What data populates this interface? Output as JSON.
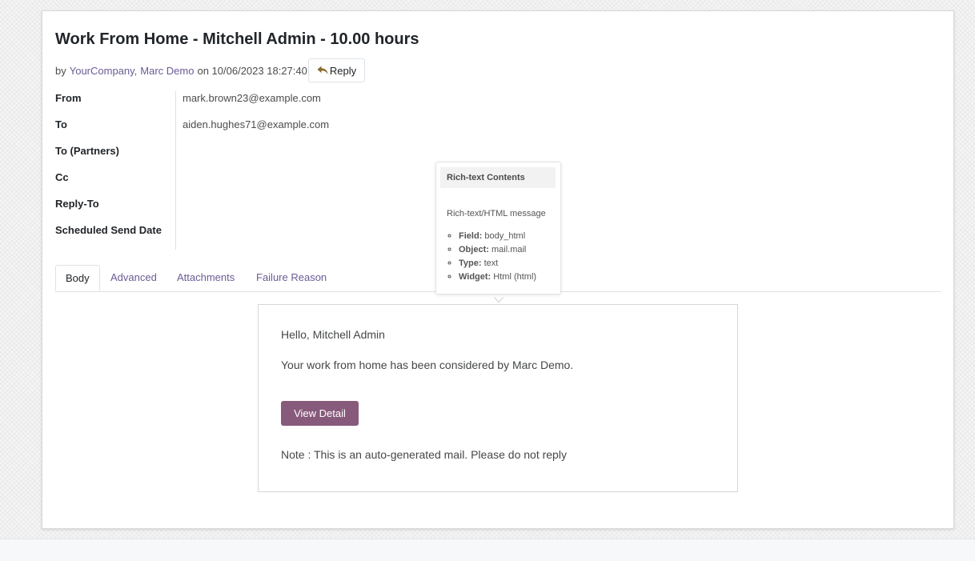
{
  "record": {
    "title": "Work From Home - Mitchell Admin - 10.00 hours",
    "by_prefix": "by",
    "authors": [
      "YourCompany,",
      "Marc Demo"
    ],
    "on_text": "on 10/06/2023 18:27:40",
    "reply_label": "Reply"
  },
  "fields": [
    {
      "label": "From",
      "value": "mark.brown23@example.com"
    },
    {
      "label": "To",
      "value": "aiden.hughes71@example.com"
    },
    {
      "label": "To (Partners)",
      "value": ""
    },
    {
      "label": "Cc",
      "value": ""
    },
    {
      "label": "Reply-To",
      "value": ""
    },
    {
      "label": "Scheduled Send Date",
      "value": ""
    }
  ],
  "tabs": [
    "Body",
    "Advanced",
    "Attachments",
    "Failure Reason"
  ],
  "mail_body": {
    "greeting": "Hello, Mitchell Admin",
    "message": "Your work from home has been considered by Marc Demo.",
    "button_label": "View Detail",
    "note": "Note : This is an auto-generated mail. Please do not reply"
  },
  "tooltip": {
    "header": "Rich-text Contents",
    "description": "Rich-text/HTML message",
    "items": [
      {
        "key": "Field:",
        "value": "body_html"
      },
      {
        "key": "Object:",
        "value": "mail.mail"
      },
      {
        "key": "Type:",
        "value": "text"
      },
      {
        "key": "Widget:",
        "value": "Html (html)"
      }
    ]
  },
  "colors": {
    "primary": "#875a7b",
    "link": "#6b5b95"
  },
  "icons": {
    "reply": "reply-arrow-icon",
    "tooltip_pointer": "chevron-down-icon"
  }
}
